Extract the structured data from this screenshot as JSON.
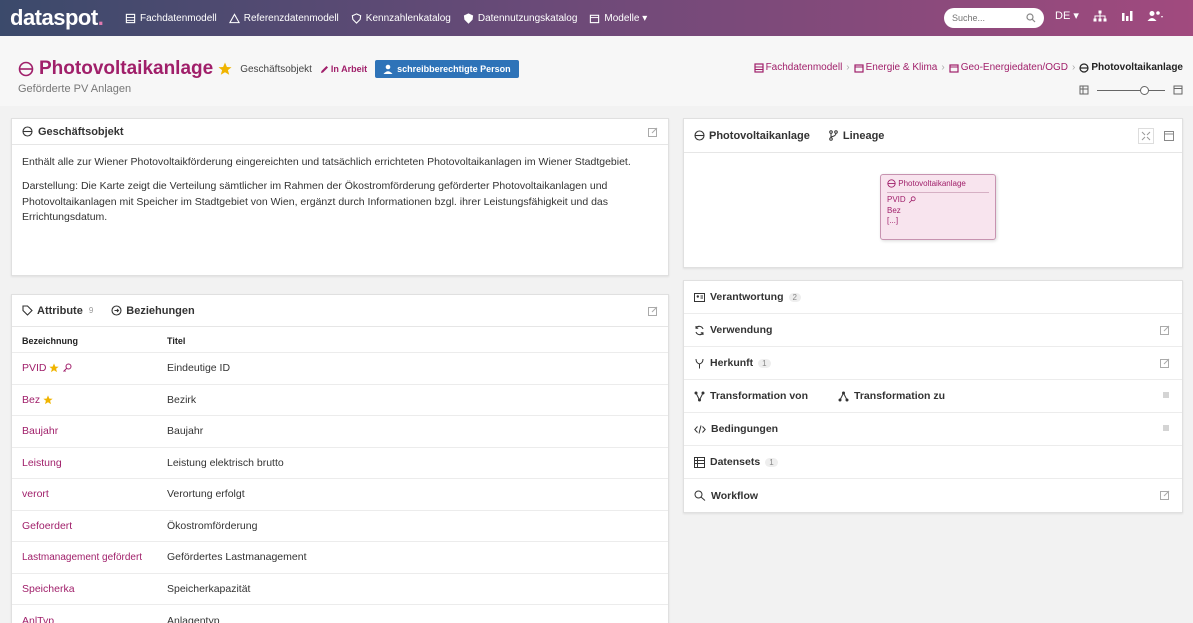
{
  "app": {
    "logo": "dataspot",
    "logo_dot": "."
  },
  "nav": [
    {
      "label": "Fachdatenmodell",
      "icon": "database-icon"
    },
    {
      "label": "Referenzdatenmodell",
      "icon": "triangle-icon"
    },
    {
      "label": "Kennzahlenkatalog",
      "icon": "shield-icon"
    },
    {
      "label": "Datennutzungskatalog",
      "icon": "shield-icon"
    },
    {
      "label": "Modelle ▾",
      "icon": "box-icon"
    }
  ],
  "search": {
    "placeholder": "Suche..."
  },
  "topright": {
    "lang": "DE ▾"
  },
  "header": {
    "title": "Photovoltaikanlage",
    "subtitle": "Geförderte PV Anlagen",
    "object_type": "Geschäftsobjekt",
    "status": "In Arbeit",
    "person_button": "schreibberechtigte Person"
  },
  "breadcrumb": [
    {
      "label": "Fachdatenmodell"
    },
    {
      "label": "Energie & Klima"
    },
    {
      "label": "Geo-Energiedaten/OGD"
    },
    {
      "label": "Photovoltaikanlage"
    }
  ],
  "business_object": {
    "heading": "Geschäftsobjekt",
    "paragraphs": [
      "Enthält alle zur Wiener Photovoltaikförderung eingereichten und tatsächlich errichteten Photovoltaikanlagen im Wiener Stadtgebiet.",
      "Darstellung: Die Karte zeigt die Verteilung sämtlicher im Rahmen der Ökostromförderung geförderter Photovoltaikanlagen und Photovoltaikanlagen mit Speicher im Stadtgebiet von Wien, ergänzt durch Informationen bzgl. ihrer Leistungsfähigkeit und das Errichtungsdatum."
    ]
  },
  "attributes": {
    "tab_attributes": "Attribute",
    "tab_attributes_count": "9",
    "tab_relations": "Beziehungen",
    "col_name": "Bezeichnung",
    "col_title": "Titel",
    "rows": [
      {
        "name": "PVID",
        "title": "Eindeutige ID"
      },
      {
        "name": "Bez",
        "title": "Bezirk"
      },
      {
        "name": "Baujahr",
        "title": "Baujahr"
      },
      {
        "name": "Leistung",
        "title": "Leistung elektrisch brutto"
      },
      {
        "name": "verort",
        "title": "Verortung erfolgt"
      },
      {
        "name": "Gefoerdert",
        "title": "Ökostromförderung"
      },
      {
        "name": "Lastmanagement gefördert",
        "title": "Gefördertes Lastmanagement"
      },
      {
        "name": "Speicherka",
        "title": "Speicherkapazität"
      },
      {
        "name": "AnlTyp",
        "title": "Anlagentyp"
      }
    ]
  },
  "lineage": {
    "tab_object": "Photovoltaikanlage",
    "tab_lineage": "Lineage",
    "node_title": "Photovoltaikanlage",
    "node_lines": [
      "PVID",
      "Bez",
      "[...]"
    ]
  },
  "sections": {
    "verantwortung": "Verantwortung",
    "verantwortung_count": "2",
    "verwendung": "Verwendung",
    "herkunft": "Herkunft",
    "herkunft_count": "1",
    "transformation_von": "Transformation von",
    "transformation_zu": "Transformation zu",
    "bedingungen": "Bedingungen",
    "datensets": "Datensets",
    "datensets_count": "1",
    "workflow": "Workflow"
  },
  "colors": {
    "accent": "#a01f6a",
    "button": "#2e73b8",
    "star": "#f0b400"
  }
}
